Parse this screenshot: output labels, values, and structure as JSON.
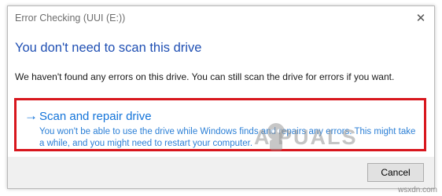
{
  "window": {
    "title": "Error Checking (UUI (E:))",
    "close_icon": "close-icon"
  },
  "main": {
    "heading": "You don't need to scan this drive",
    "message": "We haven't found any errors on this drive. You can still scan the drive for errors if you want."
  },
  "command_link": {
    "arrow_icon": "arrow-right-icon",
    "title": "Scan and repair drive",
    "description": "You won't be able to use the drive while Windows finds and repairs any errors. This might take a while, and you might need to restart your computer.",
    "highlight_color": "#d8161d",
    "accent_color": "#1273d9"
  },
  "footer": {
    "cancel_label": "Cancel"
  },
  "watermark": {
    "text": "A PUALS"
  },
  "site_tag": "wsxdn.com",
  "colors": {
    "heading": "#1f4fb3",
    "footer_bg": "#f0f0f0"
  }
}
